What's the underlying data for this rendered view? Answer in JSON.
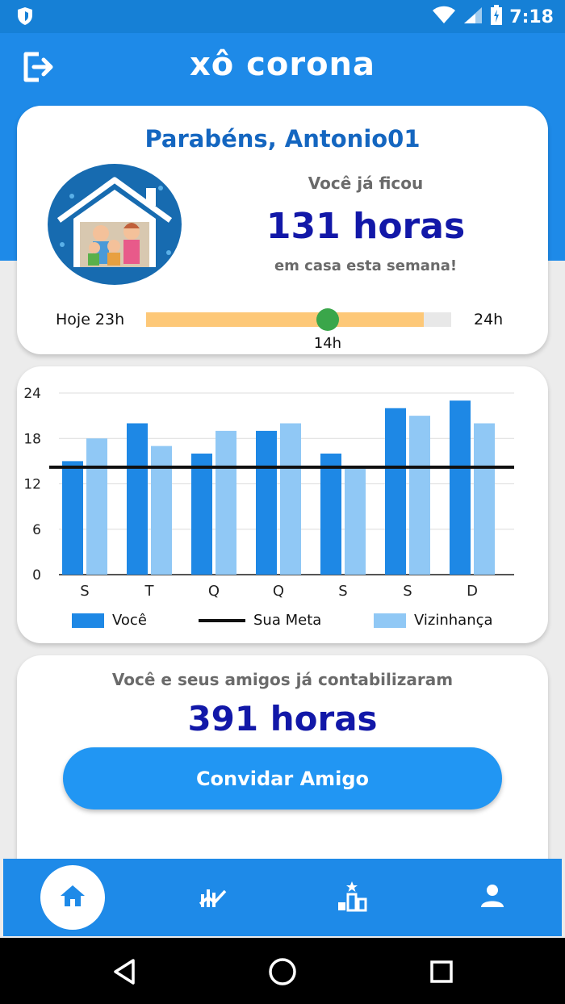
{
  "status_bar": {
    "time": "7:18"
  },
  "app": {
    "title": "xô corona"
  },
  "summary": {
    "greeting": "Parabéns, Antonio01",
    "pre_text": "Você já ficou",
    "hours": "131 horas",
    "post_text": "em casa esta semana!"
  },
  "progress": {
    "left_label": "Hoje 23h",
    "right_label": "24h",
    "fill_fraction": 0.91,
    "marker_label": "14h",
    "marker_fraction": 0.595
  },
  "chart_data": {
    "type": "bar",
    "categories": [
      "S",
      "T",
      "Q",
      "Q",
      "S",
      "S",
      "D"
    ],
    "series": [
      {
        "name": "Você",
        "values": [
          15,
          20,
          16,
          19,
          16,
          22,
          23
        ],
        "color": "#1e88e5"
      },
      {
        "name": "Vizinhança",
        "values": [
          18,
          17,
          19,
          20,
          14,
          21,
          20
        ],
        "color": "#90c8f5"
      }
    ],
    "goal": {
      "name": "Sua Meta",
      "value": 14.2,
      "color": "#111111"
    },
    "yticks": [
      0,
      6,
      12,
      18,
      24
    ],
    "ylim": [
      0,
      24
    ],
    "grid": true,
    "legend_position": "bottom"
  },
  "friends": {
    "text": "Você e seus amigos já contabilizaram",
    "hours": "391 horas",
    "invite_label": "Convidar Amigo"
  },
  "colors": {
    "primary": "#1e8ae8",
    "dark_blue_text": "#1218a8",
    "greeting_blue": "#1466c0",
    "progress_fill": "#fdc878",
    "marker_green": "#3aa64a"
  },
  "icons": {
    "logout": "logout-icon",
    "home": "home-icon",
    "stats": "chart-trend-icon",
    "ranking": "podium-icon",
    "profile": "person-icon"
  }
}
